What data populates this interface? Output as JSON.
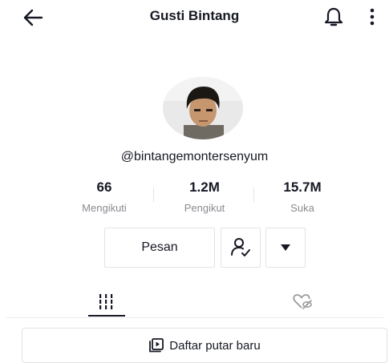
{
  "header": {
    "title": "Gusti Bintang"
  },
  "profile": {
    "username": "@bintangemontersenyum"
  },
  "stats": [
    {
      "value": "66",
      "label": "Mengikuti"
    },
    {
      "value": "1.2M",
      "label": "Pengikut"
    },
    {
      "value": "15.7M",
      "label": "Suka"
    }
  ],
  "actions": {
    "message_label": "Pesan"
  },
  "playlist": {
    "label": "Daftar putar baru"
  },
  "icons": {
    "back": "arrow-left-icon",
    "notifications": "bell-icon",
    "more": "more-vertical-icon",
    "following": "user-check-icon",
    "dropdown": "caret-down-icon",
    "videos_tab": "grid-icon",
    "liked_tab": "hidden-heart-icon",
    "playlist": "playlist-icon"
  }
}
